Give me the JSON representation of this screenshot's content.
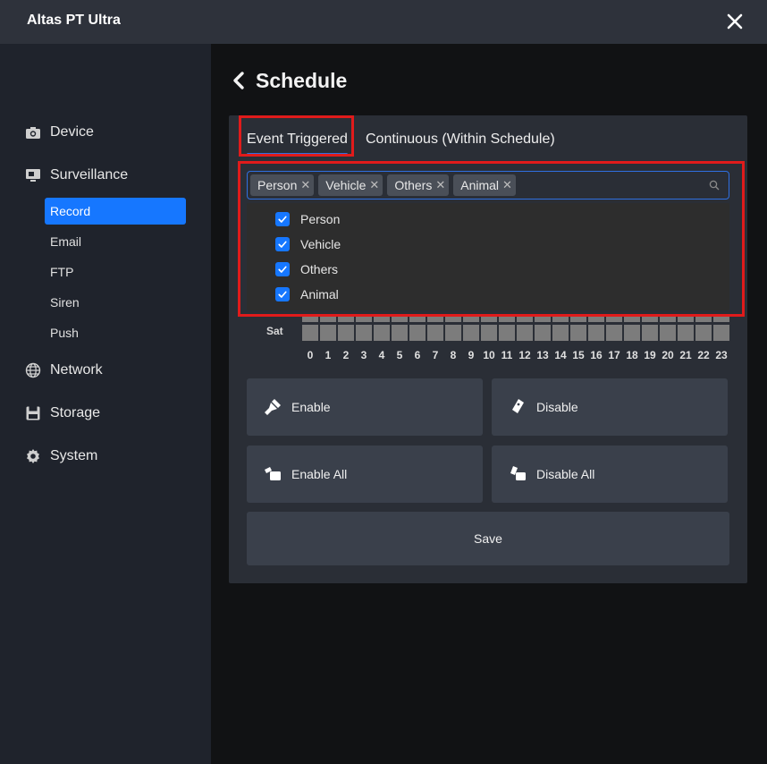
{
  "window": {
    "title": "Altas PT Ultra"
  },
  "sidebar": {
    "items": [
      {
        "label": "Device"
      },
      {
        "label": "Surveillance"
      },
      {
        "label": "Network"
      },
      {
        "label": "Storage"
      },
      {
        "label": "System"
      }
    ],
    "surveillance_sub": [
      {
        "label": "Record",
        "active": true
      },
      {
        "label": "Email"
      },
      {
        "label": "FTP"
      },
      {
        "label": "Siren"
      },
      {
        "label": "Push"
      }
    ]
  },
  "page": {
    "title": "Schedule"
  },
  "tabs": [
    {
      "label": "Event Triggered",
      "active": true
    },
    {
      "label": "Continuous (Within Schedule)"
    }
  ],
  "event_select": {
    "tags": [
      "Person",
      "Vehicle",
      "Others",
      "Animal"
    ],
    "options": [
      {
        "label": "Person",
        "checked": true
      },
      {
        "label": "Vehicle",
        "checked": true
      },
      {
        "label": "Others",
        "checked": true
      },
      {
        "label": "Animal",
        "checked": true
      }
    ]
  },
  "schedule": {
    "visible_day": "Sat",
    "hours": [
      "0",
      "1",
      "2",
      "3",
      "4",
      "5",
      "6",
      "7",
      "8",
      "9",
      "10",
      "11",
      "12",
      "13",
      "14",
      "15",
      "16",
      "17",
      "18",
      "19",
      "20",
      "21",
      "22",
      "23"
    ]
  },
  "buttons": {
    "enable": "Enable",
    "disable": "Disable",
    "enable_all": "Enable All",
    "disable_all": "Disable All",
    "save": "Save"
  },
  "colors": {
    "accent": "#1677ff",
    "highlight": "#e01b1b"
  }
}
